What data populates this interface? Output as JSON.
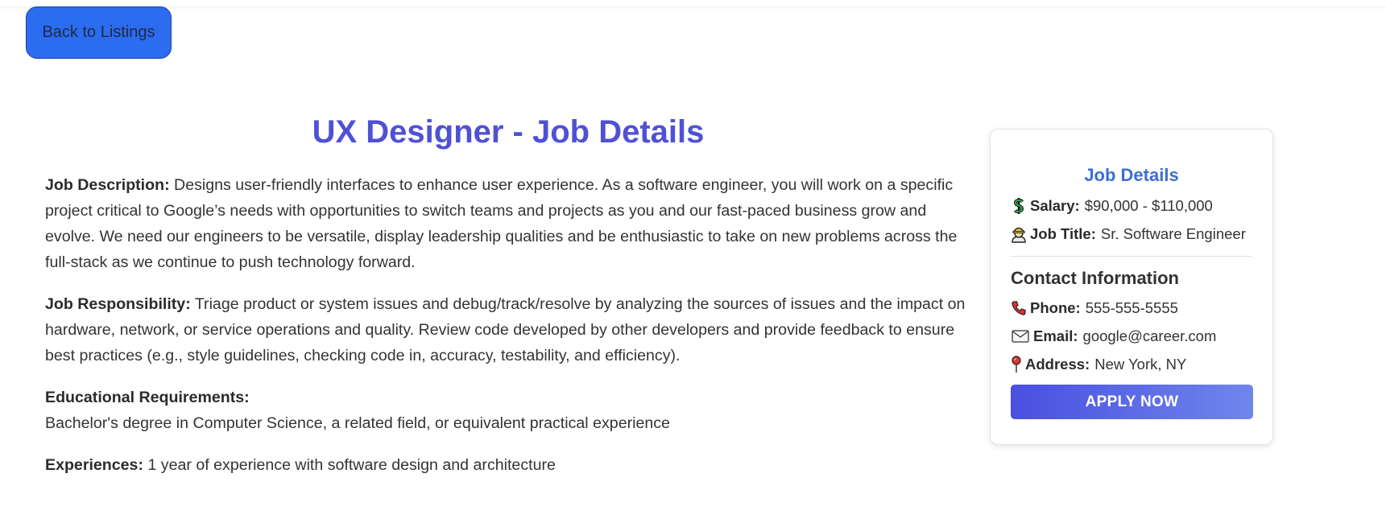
{
  "nav": {
    "back_label": "Back to Listings"
  },
  "job": {
    "title": "UX Designer - Job Details",
    "description_label": "Job Description:",
    "description": "Designs user-friendly interfaces to enhance user experience. As a software engineer, you will work on a specific project critical to Google’s needs with opportunities to switch teams and projects as you and our fast-paced business grow and evolve. We need our engineers to be versatile, display leadership qualities and be enthusiastic to take on new problems across the full-stack as we continue to push technology forward.",
    "responsibility_label": "Job Responsibility:",
    "responsibility": "Triage product or system issues and debug/track/resolve by analyzing the sources of issues and the impact on hardware, network, or service operations and quality. Review code developed by other developers and provide feedback to ensure best practices (e.g., style guidelines, checking code in, accuracy, testability, and efficiency).",
    "education_label": "Educational Requirements:",
    "education": "Bachelor's degree in Computer Science, a related field, or equivalent practical experience",
    "experience_label": "Experiences:",
    "experience": "1 year of experience with software design and architecture"
  },
  "card": {
    "title": "Job Details",
    "salary_label": "Salary:",
    "salary": "$90,000 - $110,000",
    "salary_icon": "dollar-sign-icon",
    "job_title_label": "Job Title:",
    "job_title": "Sr. Software Engineer",
    "job_title_icon": "worker-icon",
    "contact_title": "Contact Information",
    "phone_label": "Phone:",
    "phone": "555-555-5555",
    "phone_icon": "phone-icon",
    "email_label": "Email:",
    "email": "google@career.com",
    "email_icon": "envelope-icon",
    "address_label": "Address:",
    "address": "New York, NY",
    "address_icon": "pushpin-icon",
    "apply_label": "APPLY NOW"
  },
  "colors": {
    "title": "#4f51d4",
    "card_title": "#3b6fd1",
    "back_button": "#2b6cf0",
    "apply_start": "#4a4fe0",
    "apply_end": "#6f86ec"
  }
}
